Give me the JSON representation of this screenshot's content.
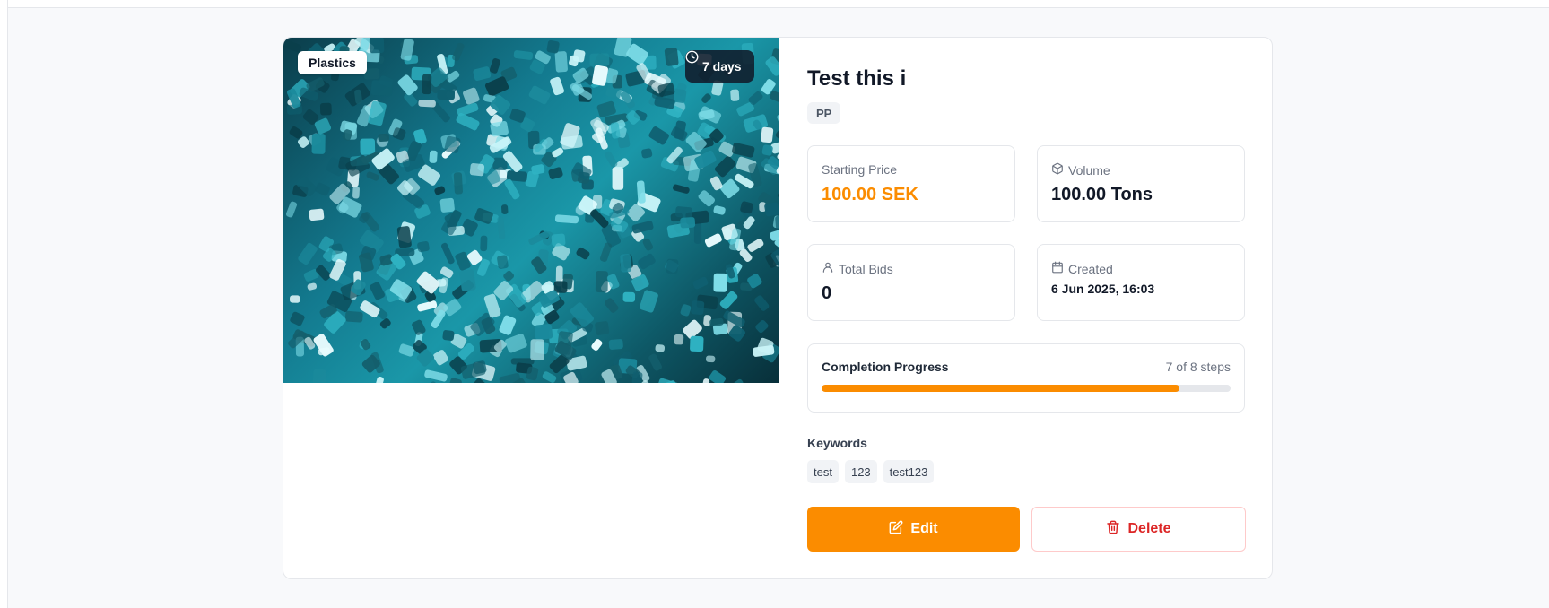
{
  "listing": {
    "category": "Plastics",
    "time_left": "7 days",
    "title": "Test this i",
    "material_tag": "PP",
    "stats": {
      "starting_price_label": "Starting Price",
      "starting_price_value": "100.00 SEK",
      "volume_label": "Volume",
      "volume_value": "100.00 Tons",
      "total_bids_label": "Total Bids",
      "total_bids_value": "0",
      "created_label": "Created",
      "created_value": "6 Jun 2025, 16:03"
    },
    "progress": {
      "label": "Completion Progress",
      "steps_text": "7 of 8 steps",
      "completed": 7,
      "total": 8
    },
    "keywords_label": "Keywords",
    "keywords": [
      "test",
      "123",
      "test123"
    ],
    "actions": {
      "edit_label": "Edit",
      "delete_label": "Delete"
    }
  },
  "colors": {
    "accent": "#fb8c00",
    "danger": "#dc2626"
  },
  "icons": {
    "time_badge": "clock-icon",
    "volume": "box-icon",
    "total_bids": "user-icon",
    "created": "calendar-icon",
    "edit": "edit-icon",
    "delete": "trash-icon"
  }
}
